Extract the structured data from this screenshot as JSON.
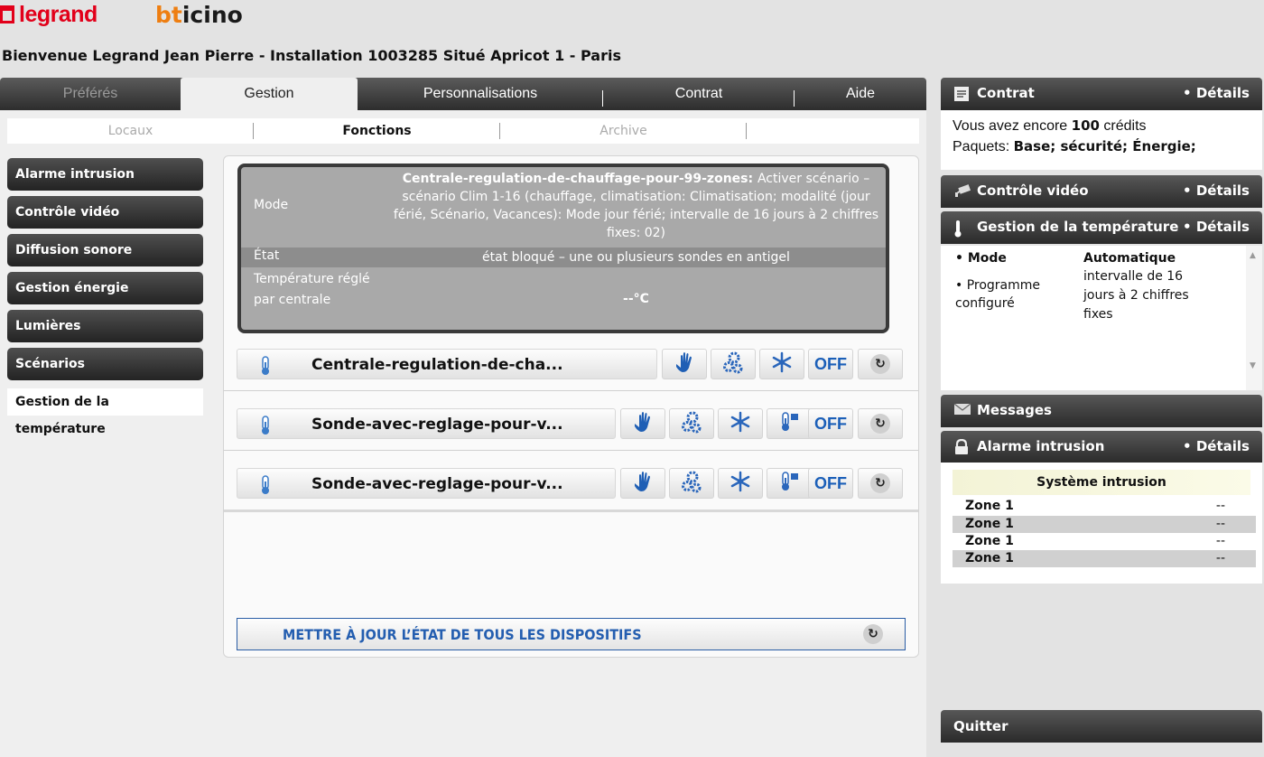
{
  "brand": {
    "legrand": "legrand",
    "bticino_b": "bt",
    "bticino_rest": "icino"
  },
  "welcome": "Bienvenue Legrand Jean Pierre - Installation 1003285 Situé Apricot 1 - Paris",
  "tabs": [
    {
      "label": "Préférés",
      "state": "disabled"
    },
    {
      "label": "Gestion",
      "state": "active"
    },
    {
      "label": "Personnalisations"
    },
    {
      "label": "Contrat"
    },
    {
      "label": "Aide"
    }
  ],
  "subtabs": [
    {
      "label": "Locaux",
      "state": "disabled"
    },
    {
      "label": "Fonctions",
      "state": "active"
    },
    {
      "label": "Archive",
      "state": "disabled"
    }
  ],
  "sidebar": {
    "items": [
      {
        "label": "Alarme intrusion"
      },
      {
        "label": "Contrôle vidéo"
      },
      {
        "label": "Diffusion sonore"
      },
      {
        "label": "Gestion énergie"
      },
      {
        "label": "Lumières"
      },
      {
        "label": "Scénarios"
      },
      {
        "label": "Gestion de la température",
        "active": true
      }
    ]
  },
  "status": {
    "mode_label": "Mode",
    "mode_bold": "Centrale-regulation-de-chauffage-pour-99-zones:",
    "mode_value": "Activer scénario – scénario Clim 1-16 (chauffage, climatisation: Climatisation; modalité (jour férié, Scénario, Vacances): Mode jour férié; intervalle de 16 jours à 2 chiffres fixes: 02)",
    "etat_label": "État",
    "etat_value": "état bloqué – une ou plusieurs sondes en antigel",
    "temp_label": "Température réglé par centrale",
    "temp_value": "--°C"
  },
  "devices": [
    {
      "name": "Centrale-regulation-de-cha...",
      "off_label": "OFF",
      "buttons": [
        "manual-hand-icon",
        "program-gears-icon",
        "antifreeze-snowflake-icon",
        "off-button",
        "refresh-icon"
      ]
    },
    {
      "name": "Sonde-avec-reglage-pour-v...",
      "off_label": "OFF",
      "buttons": [
        "manual-hand-icon",
        "program-gears-icon",
        "antifreeze-snowflake-icon",
        "local-thermostat-icon",
        "off-button",
        "refresh-icon"
      ]
    },
    {
      "name": "Sonde-avec-reglage-pour-v...",
      "off_label": "OFF",
      "buttons": [
        "manual-hand-icon",
        "program-gears-icon",
        "antifreeze-snowflake-icon",
        "local-thermostat-icon",
        "off-button",
        "refresh-icon"
      ]
    }
  ],
  "update_button": "METTRE À JOUR L’ÉTAT DE TOUS LES DISPOSITIFS",
  "widgets": {
    "details": "• Détails",
    "contrat": {
      "title": "Contrat",
      "line1_prefix": "Vous avez encore",
      "credits": "100",
      "line1_suffix": "crédits",
      "line2_prefix": "Paquets:",
      "packages": "Base; sécurité; Énergie;"
    },
    "video": {
      "title": "Contrôle vidéo"
    },
    "temperature": {
      "title": "Gestion de la température",
      "mode_label": "• Mode",
      "mode_value": "Automatique",
      "prog_label_1": "• Programme",
      "prog_label_2": "configuré",
      "prog_value_1": "intervalle de 16",
      "prog_value_2": "jours à 2 chiffres",
      "prog_value_3": "fixes"
    },
    "messages": {
      "title": "Messages"
    },
    "alarme": {
      "title": "Alarme intrusion",
      "system": "Système intrusion",
      "zones": [
        {
          "name": "Zone 1",
          "value": "--"
        },
        {
          "name": "Zone 1",
          "value": "--"
        },
        {
          "name": "Zone 1",
          "value": "--"
        },
        {
          "name": "Zone 1",
          "value": "--"
        }
      ]
    }
  },
  "quit": "Quitter",
  "colors": {
    "accent_blue": "#245eb0",
    "legrand_red": "#e2001a",
    "bticino_orange": "#ee7e11",
    "dark_bar": "#2d2d2d"
  }
}
